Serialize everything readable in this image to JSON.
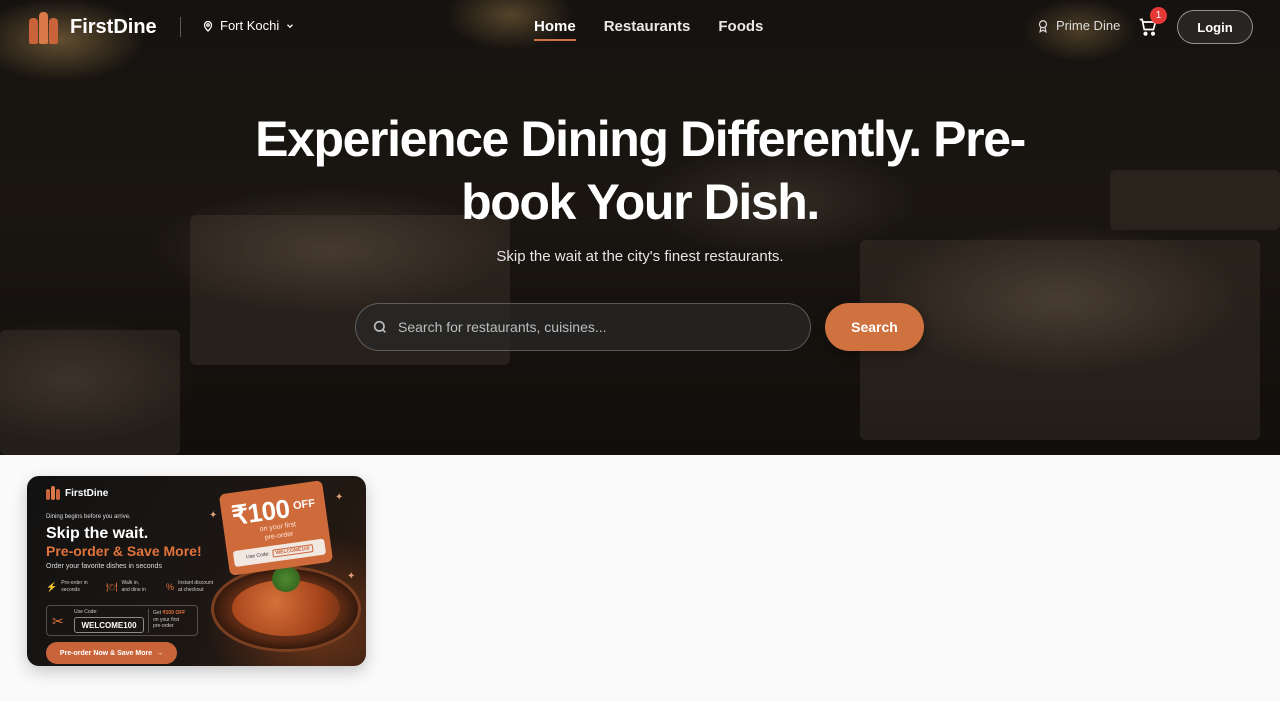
{
  "brand": {
    "name": "FirstDine"
  },
  "nav": {
    "location": "Fort Kochi",
    "links": [
      {
        "label": "Home",
        "active": true
      },
      {
        "label": "Restaurants",
        "active": false
      },
      {
        "label": "Foods",
        "active": false
      }
    ],
    "prime_label": "Prime Dine",
    "cart_count": "1",
    "login_label": "Login"
  },
  "hero": {
    "title": "Experience Dining Differently. Pre-book Your Dish.",
    "subtitle": "Skip the wait at the city's finest restaurants.",
    "search_placeholder": "Search for restaurants, cuisines...",
    "search_button": "Search"
  },
  "promo": {
    "brand": "FirstDine",
    "tagline": "Dining begins before you arrive.",
    "headline": "Skip the wait.",
    "headline_accent": "Pre-order & Save More!",
    "subline": "Order your favorite dishes in seconds",
    "features": [
      {
        "icon": "lightning-icon",
        "line1": "Pre-order in",
        "line2": "seconds"
      },
      {
        "icon": "cutlery-icon",
        "line1": "Walk in,",
        "line2": "and dine in"
      },
      {
        "icon": "discount-icon",
        "line1": "Instant discount",
        "line2": "at checkout"
      }
    ],
    "code_label": "Use Code:",
    "code": "WELCOME100",
    "offer_prefix": "Get",
    "offer_amount": "₹100 OFF",
    "offer_line2": "on your first",
    "offer_line3": "pre-order",
    "cta": "Pre-order Now & Save More",
    "ticket_amount": "₹100",
    "ticket_off": "OFF",
    "ticket_sub1": "on your first",
    "ticket_sub2": "pre-order",
    "ticket_code_label": "Use Code:",
    "ticket_code": "WELCOME100"
  },
  "colors": {
    "accent": "#d0723f",
    "badge": "#e53935"
  }
}
